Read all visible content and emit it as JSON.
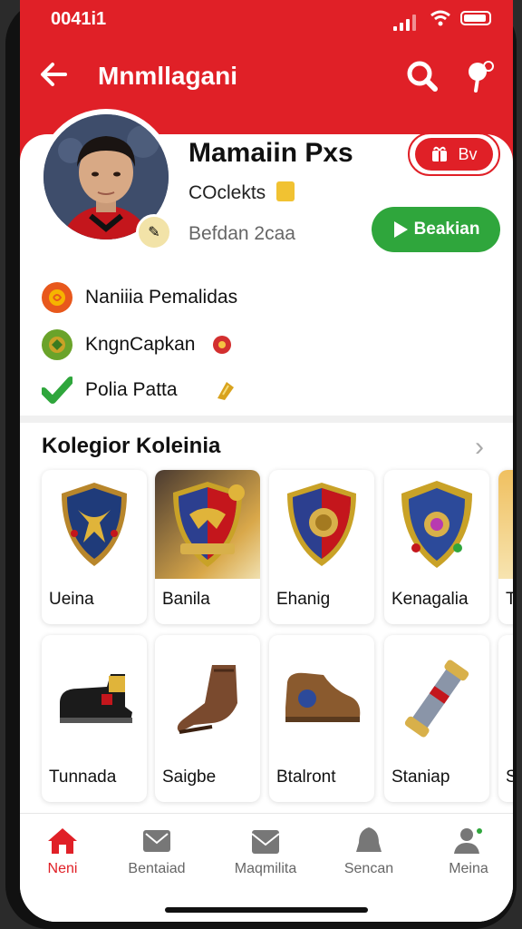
{
  "status": {
    "time": "0041i1"
  },
  "topbar": {
    "title": "Mnmllagani",
    "back_icon": "back-arrow-icon",
    "search_icon": "search-icon",
    "settings_icon": "pin-icon"
  },
  "profile": {
    "name": "Mamaiin Pxs",
    "line1": "COclekts",
    "line2": "Befdan 2caa",
    "btn_red_label": "Bv",
    "btn_green_label": "Beakian"
  },
  "stats": [
    {
      "label": "Naniiia Pemalidas",
      "icon": "coin-icon",
      "color": "#e8581c"
    },
    {
      "label": "KngnCapkan",
      "icon": "ball-icon",
      "color": "#6aa32a"
    },
    {
      "label": "Polia Patta",
      "icon": "check-icon",
      "color": "#2fa63c"
    }
  ],
  "collection": {
    "title": "Kolegior Koleinia",
    "items_row1": [
      {
        "label": "Ueina",
        "icon": "shield-badge-icon"
      },
      {
        "label": "Banila",
        "icon": "crest-badge-icon"
      },
      {
        "label": "Ehanig",
        "icon": "round-shield-icon"
      },
      {
        "label": "Kenagalia",
        "icon": "ornate-shield-icon"
      },
      {
        "label": "T",
        "icon": "partial-item-icon"
      }
    ],
    "items_row2": [
      {
        "label": "Tunnada",
        "icon": "black-boot-icon"
      },
      {
        "label": "Saigbe",
        "icon": "brown-boot-icon"
      },
      {
        "label": "Btalront",
        "icon": "leather-shoe-icon"
      },
      {
        "label": "Staniap",
        "icon": "scroll-tube-icon"
      },
      {
        "label": "S",
        "icon": "partial-item-icon"
      }
    ]
  },
  "nav": [
    {
      "label": "Neni",
      "icon": "home-icon",
      "active": true
    },
    {
      "label": "Bentaiad",
      "icon": "mail-icon",
      "active": false
    },
    {
      "label": "Maqmilita",
      "icon": "envelope-icon",
      "active": false
    },
    {
      "label": "Sencan",
      "icon": "bell-icon",
      "active": false
    },
    {
      "label": "Meina",
      "icon": "user-icon",
      "active": false
    }
  ],
  "colors": {
    "brand_red": "#e02027",
    "green": "#2fa63c"
  }
}
